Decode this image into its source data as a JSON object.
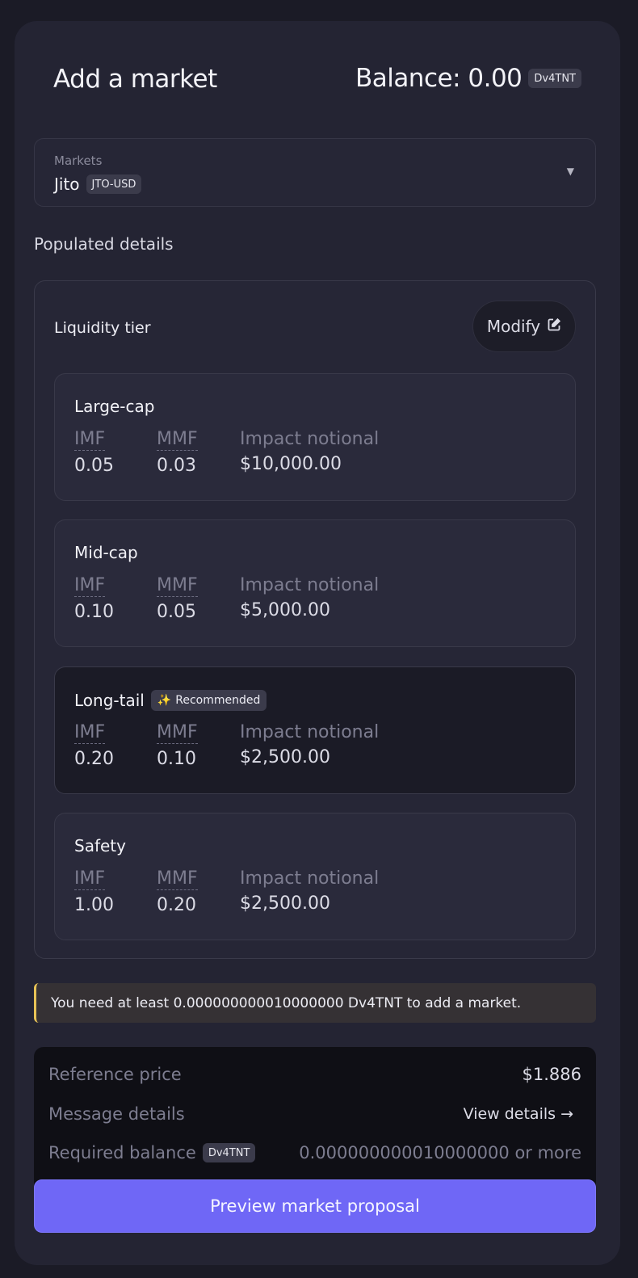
{
  "dialog": {
    "title": "Add a market",
    "balance_label": "Balance: 0.00",
    "balance_token": "Dv4TNT"
  },
  "market_select": {
    "label": "Markets",
    "name": "Jito",
    "ticker": "JTO-USD",
    "caret_icon": "triangle-down-icon"
  },
  "populated_details": {
    "section_title": "Populated details",
    "panel_title": "Liquidity tier",
    "modify_label": "Modify",
    "modify_icon": "edit-icon",
    "columns": {
      "imf": "IMF",
      "mmf": "MMF",
      "impact": "Impact notional"
    },
    "tiers": [
      {
        "name": "Large-cap",
        "imf": "0.05",
        "mmf": "0.03",
        "impact": "$10,000.00"
      },
      {
        "name": "Mid-cap",
        "imf": "0.10",
        "mmf": "0.05",
        "impact": "$5,000.00"
      },
      {
        "name": "Long-tail",
        "badge": "Recommended",
        "badge_icon": "sparkles-icon",
        "imf": "0.20",
        "mmf": "0.10",
        "impact": "$2,500.00",
        "selected": true
      },
      {
        "name": "Safety",
        "imf": "1.00",
        "mmf": "0.20",
        "impact": "$2,500.00"
      }
    ]
  },
  "warning": {
    "text": "You need at least 0.000000000010000000 Dv4TNT to add a market.",
    "accent_color": "#e7c256"
  },
  "summary": {
    "reference_price_label": "Reference price",
    "reference_price_value": "$1.886",
    "message_details_label": "Message details",
    "view_details_label": "View details →",
    "required_balance_label": "Required balance",
    "required_balance_token": "Dv4TNT",
    "required_balance_value": "0.000000000010000000 or more"
  },
  "preview_button": {
    "label": "Preview market proposal",
    "color": "#6f67f6"
  }
}
